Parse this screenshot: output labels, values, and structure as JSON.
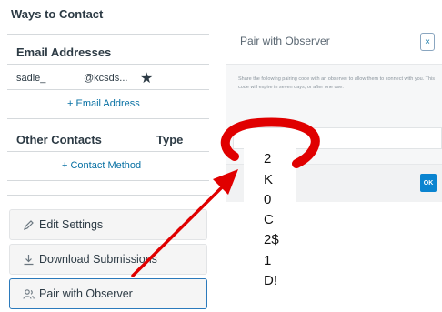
{
  "profile": {
    "title": "Ways to Contact",
    "email_heading": "Email Addresses",
    "email_user": "sadie_",
    "email_domain": "@kcsds...",
    "default_icon": "star-icon",
    "add_email": "+ Email Address",
    "other_heading": "Other Contacts",
    "type_heading": "Type",
    "add_contact": "+ Contact Method"
  },
  "sidebar_buttons": [
    {
      "label": "Edit Settings",
      "icon": "pencil-icon"
    },
    {
      "label": "Download Submissions",
      "icon": "download-icon"
    },
    {
      "label": "Pair with Observer",
      "icon": "users-icon"
    }
  ],
  "modal": {
    "title": "Pair with Observer",
    "close_label": "×",
    "description": "Share the following pairing code with an observer to allow them to connect with you. This code will expire in seven days, or after one use.",
    "ok_label": "OK"
  },
  "annotation": {
    "pairing_code": [
      "2",
      "K",
      "0",
      "C",
      "2$",
      "1",
      "D!"
    ],
    "highlight_color": "#e00000",
    "arrow_color": "#e00000"
  }
}
